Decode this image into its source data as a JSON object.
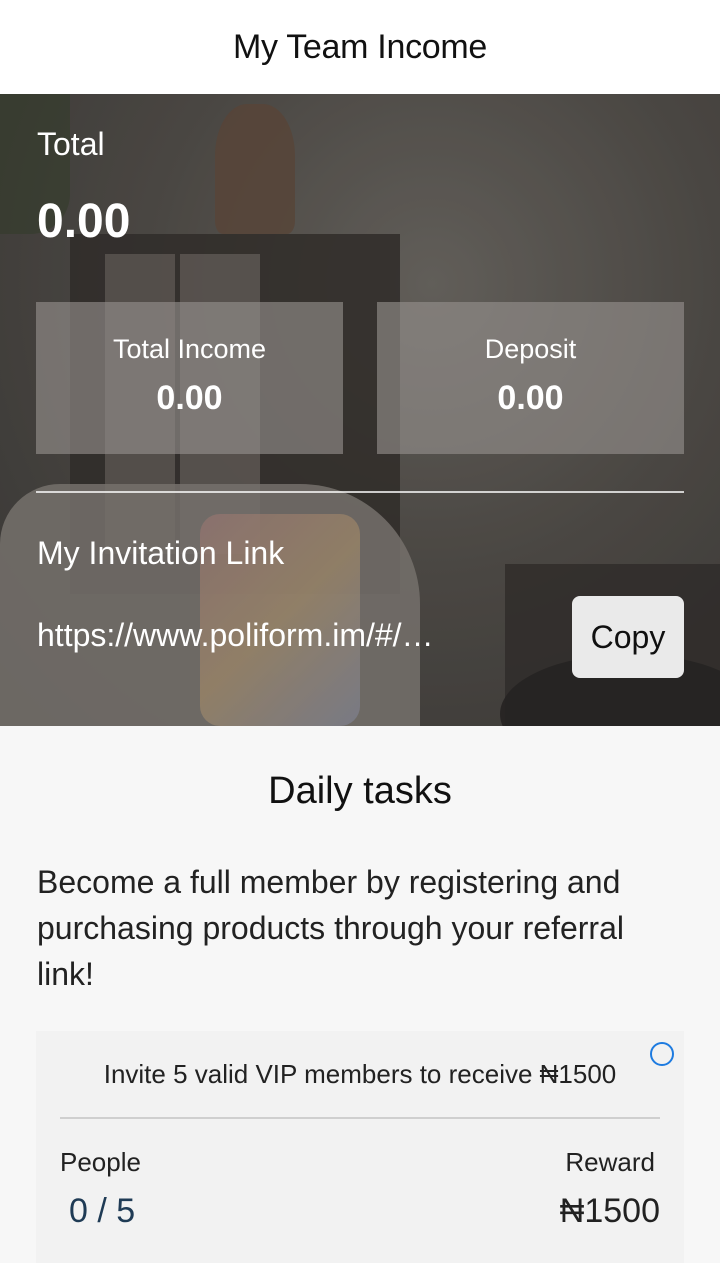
{
  "header": {
    "title": "My Team Income"
  },
  "summary": {
    "total_label": "Total",
    "total_value": "0.00",
    "stats": [
      {
        "label": "Total Income",
        "value": "0.00"
      },
      {
        "label": "Deposit",
        "value": "0.00"
      }
    ]
  },
  "invitation": {
    "label": "My Invitation Link",
    "url": "https://www.poliform.im/#/…",
    "copy_label": "Copy"
  },
  "tasks": {
    "title": "Daily tasks",
    "description": "Become a full member by registering and purchasing products through your referral link!",
    "items": [
      {
        "text": "Invite 5 valid VIP members to receive ₦1500",
        "people_label": "People",
        "people_value": "0 / 5",
        "reward_label": "Reward",
        "reward_value": "₦1500"
      }
    ]
  }
}
